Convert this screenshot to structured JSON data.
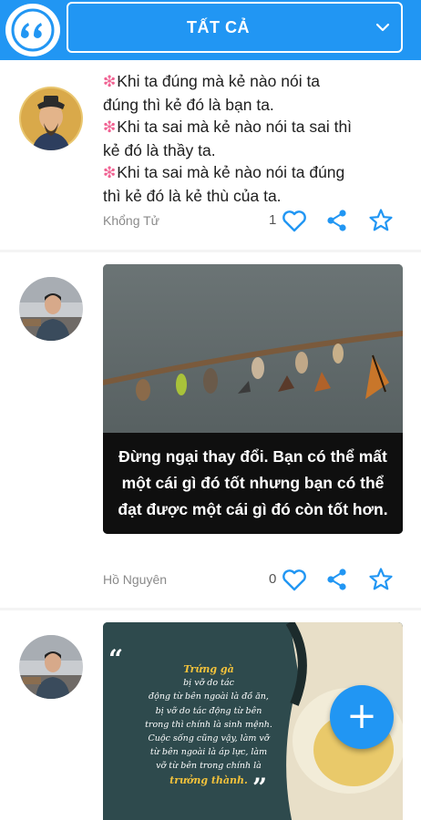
{
  "header": {
    "logo_icon": "quote-mark-logo-icon",
    "filter_label": "TẤT CẢ",
    "filter_icon": "chevron-down-icon"
  },
  "colors": {
    "primary": "#2196f3",
    "accent_flower": "#f06292"
  },
  "posts": [
    {
      "lines": [
        {
          "icon": "❇",
          "text": "Khi ta đúng mà kẻ nào nói ta"
        },
        {
          "icon": "",
          "text": "đúng thì kẻ đó là bạn ta."
        },
        {
          "icon": "❇",
          "text": "Khi ta sai mà kẻ nào nói ta sai thì"
        },
        {
          "icon": "",
          "text": "kẻ đó là thầy ta."
        },
        {
          "icon": "❇",
          "text": "Khi ta sai mà kẻ nào nói ta đúng"
        },
        {
          "icon": "",
          "text": "thì kẻ đó là kẻ thù của ta."
        }
      ],
      "author": "Khổng Tử",
      "likes": "1"
    },
    {
      "image_caption": [
        "Đừng ngại thay đổi. Bạn có thể mất",
        "một cái gì đó tốt nhưng bạn có thể",
        "đạt được một cái gì đó còn tốt hơn."
      ],
      "author": "Hồ Nguyên",
      "likes": "0"
    },
    {
      "image_text": [
        {
          "hl": "Trứng gà",
          "text": " bị vỡ do tác"
        },
        {
          "hl": "",
          "text": "động từ bên ngoài là đồ ăn,"
        },
        {
          "hl": "",
          "text": "bị vỡ do tác động từ bên"
        },
        {
          "hl": "",
          "text": "trong thì chính là sinh mệnh."
        },
        {
          "hl": "",
          "text": "Cuộc sống cũng vậy, làm vỡ"
        },
        {
          "hl": "",
          "text": "từ bên ngoài là áp lực, làm"
        },
        {
          "hl": "",
          "text": "vỡ từ bên trong chính là"
        },
        {
          "hl": "trưởng thành.",
          "text": ""
        }
      ]
    }
  ],
  "fab": {
    "label": "+"
  }
}
